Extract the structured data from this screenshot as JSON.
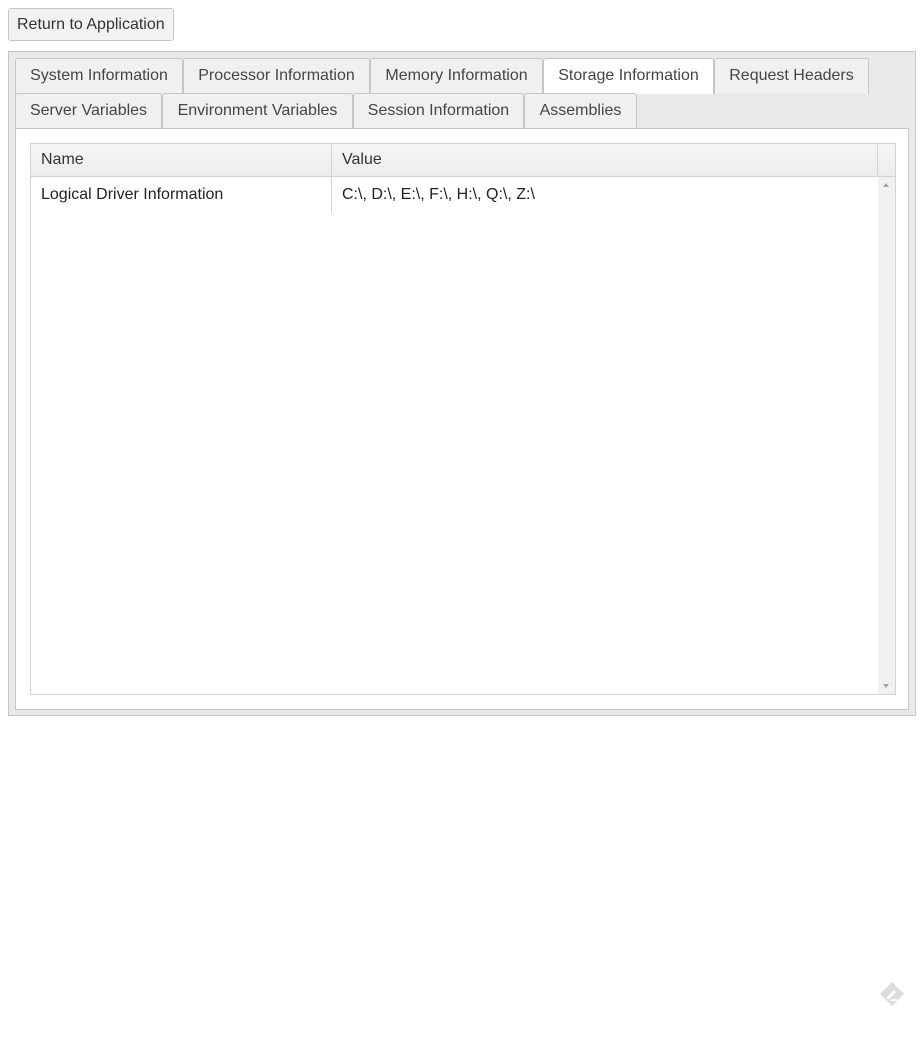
{
  "toolbar": {
    "return_label": "Return to Application"
  },
  "tabs": [
    {
      "label": "System Information",
      "active": false
    },
    {
      "label": "Processor Information",
      "active": false
    },
    {
      "label": "Memory Information",
      "active": false
    },
    {
      "label": "Storage Information",
      "active": true
    },
    {
      "label": "Request Headers",
      "active": false
    },
    {
      "label": "Server Variables",
      "active": false
    },
    {
      "label": "Environment Variables",
      "active": false
    },
    {
      "label": "Session Information",
      "active": false
    },
    {
      "label": "Assemblies",
      "active": false
    }
  ],
  "grid": {
    "columns": [
      "Name",
      "Value"
    ],
    "rows": [
      {
        "name": "Logical Driver Information",
        "value": "C:\\, D:\\, E:\\, F:\\, H:\\, Q:\\, Z:\\"
      }
    ]
  },
  "icons": {
    "corner": "feedback-pencil-icon",
    "scroll_up": "scroll-up-arrow-icon",
    "scroll_down": "scroll-down-arrow-icon"
  },
  "colors": {
    "active_tab_bg": "#ffffff",
    "inactive_tab_bg": "#f0f0f0",
    "border": "#c5c5c5"
  }
}
